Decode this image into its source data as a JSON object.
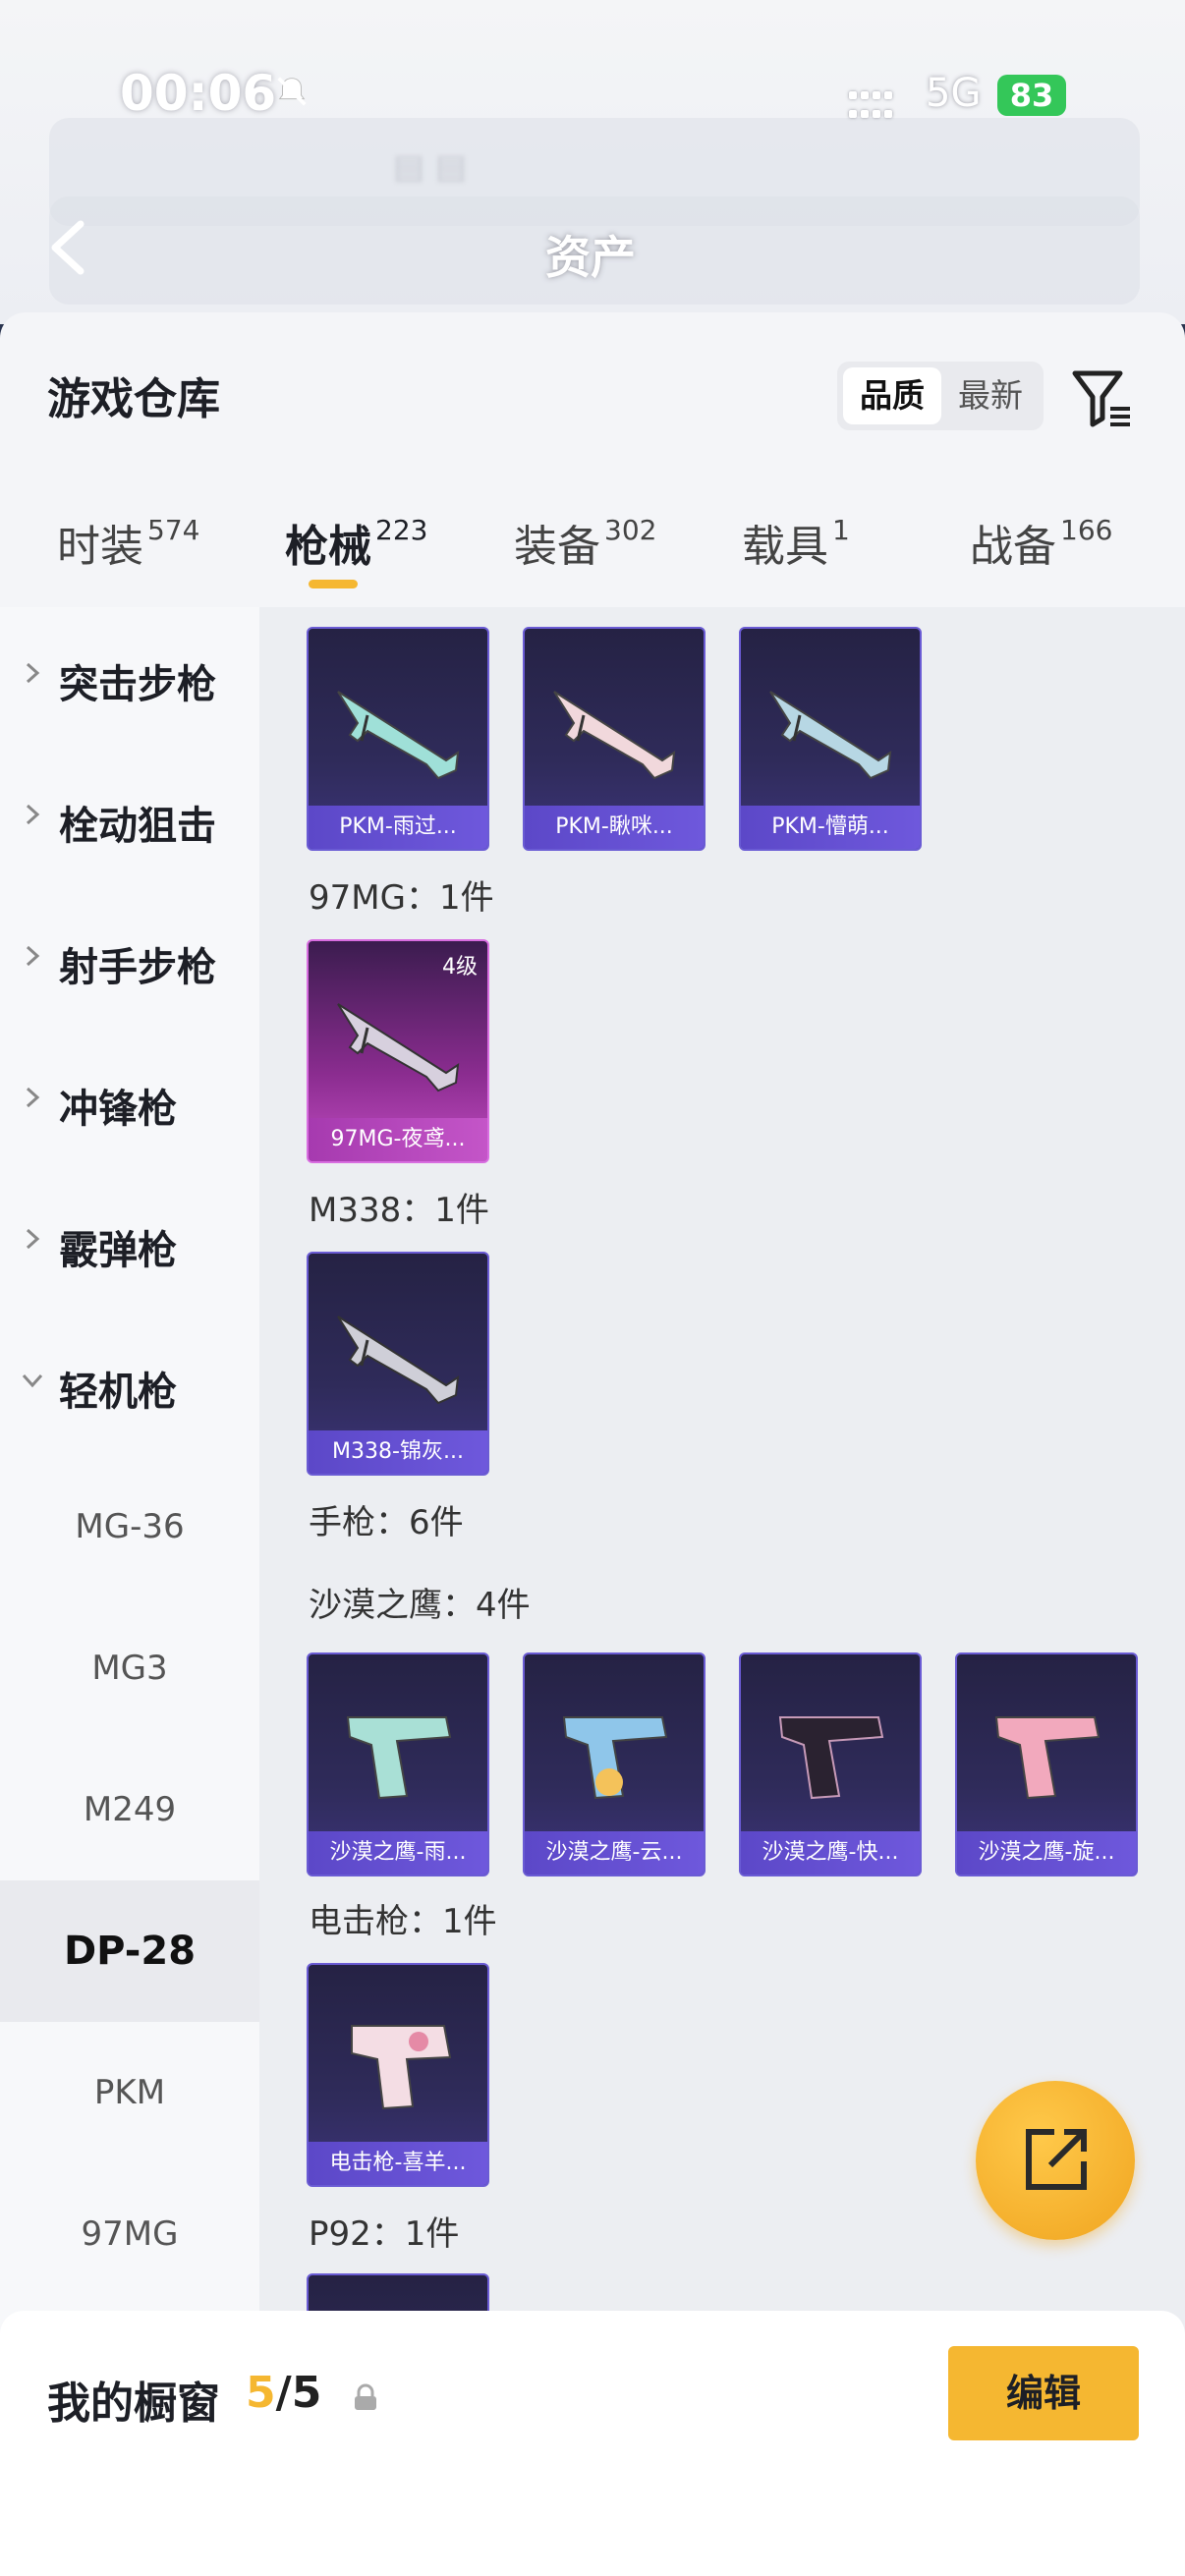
{
  "status": {
    "time": "00:06",
    "network": "5G",
    "battery": "83"
  },
  "header": {
    "title": "资产"
  },
  "warehouse": {
    "title": "游戏仓库",
    "sort_options": [
      "品质",
      "最新"
    ],
    "tabs": [
      {
        "label": "时装",
        "count": "574"
      },
      {
        "label": "枪械",
        "count": "223"
      },
      {
        "label": "装备",
        "count": "302"
      },
      {
        "label": "载具",
        "count": "1"
      },
      {
        "label": "战备",
        "count": "166"
      }
    ]
  },
  "sidebar": {
    "categories": [
      "突击步枪",
      "栓动狙击",
      "射手步枪",
      "冲锋枪",
      "霰弹枪",
      "轻机枪"
    ],
    "subcategories": [
      "MG-36",
      "MG3",
      "M249",
      "DP-28",
      "PKM",
      "97MG"
    ]
  },
  "content": {
    "groups": {
      "g97mg": "97MG：1件",
      "m338": "M338：1件",
      "pistol": "手枪：6件",
      "eagle": "沙漠之鹰：4件",
      "stun": "电击枪：1件",
      "p92": "P92：1件"
    },
    "cards": {
      "pkm1": "PKM-雨过...",
      "pkm2": "PKM-瞅咪...",
      "pkm3": "PKM-懵萌...",
      "mg97": "97MG-夜鸢...",
      "mg97_level": "4级",
      "m338": "M338-锦灰...",
      "eagle1": "沙漠之鹰-雨...",
      "eagle2": "沙漠之鹰-云...",
      "eagle3": "沙漠之鹰-快...",
      "eagle4": "沙漠之鹰-旋...",
      "stun": "电击枪-喜羊..."
    }
  },
  "showcase": {
    "title": "我的橱窗",
    "current": "5",
    "total": "/5",
    "edit_label": "编辑"
  },
  "colors": {
    "accent": "#f5b731",
    "card_border": "#6a5bd4",
    "pink_card": "#c24cc2"
  }
}
